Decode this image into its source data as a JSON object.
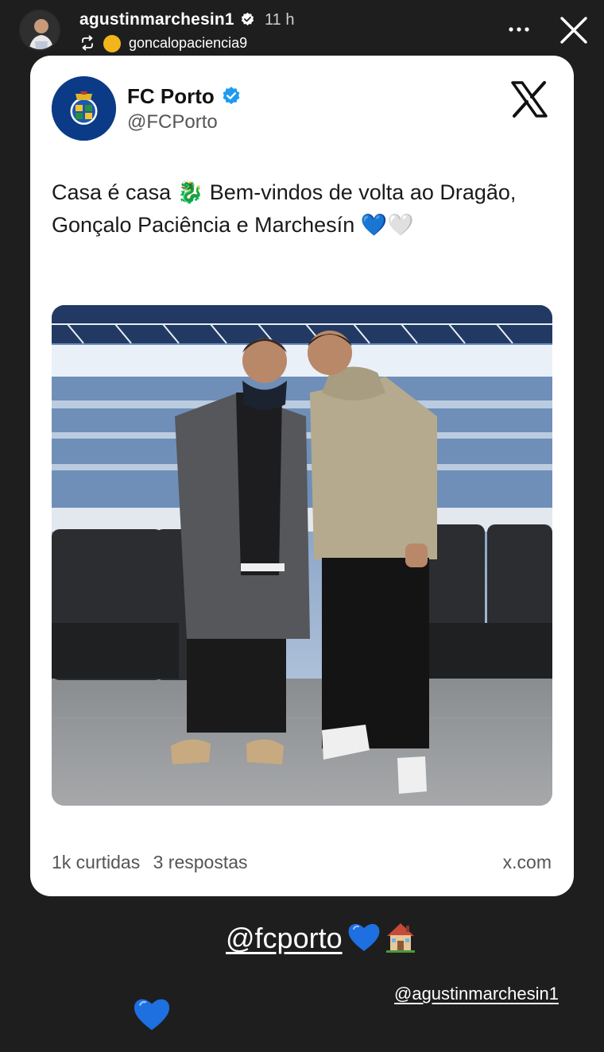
{
  "header": {
    "username": "agustinmarchesin1",
    "time": "11 h",
    "reposted_from": "goncalopaciencia9"
  },
  "post": {
    "account_name": "FC Porto",
    "handle": "@FCPorto",
    "text": "Casa é casa 🐉 Bem-vindos de volta ao Dragão, Gonçalo Paciência e Marchesín 💙🤍",
    "likes": "1k curtidas",
    "replies": "3 respostas",
    "domain": "x.com"
  },
  "stickers": {
    "mention_main": "@fcporto",
    "mention_small": "@agustinmarchesin1"
  },
  "colors": {
    "background": "#1e1e1e",
    "card": "#ffffff",
    "verified_blue": "#1d9bf0",
    "heart_blue": "#1e6fe0",
    "porto_blue": "#0b3b86"
  },
  "icons": [
    "verified-icon",
    "repost-icon",
    "more-icon",
    "close-icon",
    "x-logo-icon",
    "heart-icon",
    "house-icon"
  ]
}
